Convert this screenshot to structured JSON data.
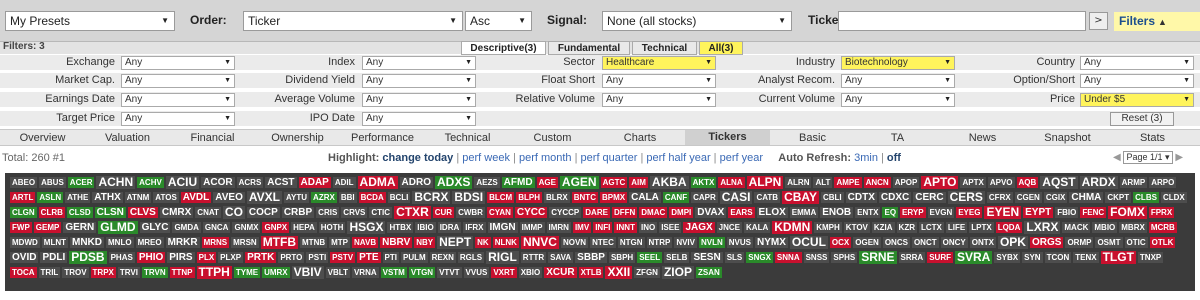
{
  "topbar": {
    "presets": "My Presets",
    "order_label": "Order:",
    "order_value": "Ticker",
    "order_dir": "Asc",
    "signal_label": "Signal:",
    "signal_value": "None (all stocks)",
    "tickers_label": "Tickers:",
    "tickers_value": "",
    "go_label": ">",
    "filters_label": "Filters"
  },
  "filter_header": {
    "count": "Filters: 3",
    "tabs": [
      "Descriptive(3)",
      "Fundamental",
      "Technical",
      "All(3)"
    ]
  },
  "filters": {
    "exchange": {
      "label": "Exchange",
      "value": "Any"
    },
    "index": {
      "label": "Index",
      "value": "Any"
    },
    "sector": {
      "label": "Sector",
      "value": "Healthcare"
    },
    "industry": {
      "label": "Industry",
      "value": "Biotechnology"
    },
    "country": {
      "label": "Country",
      "value": "Any"
    },
    "market_cap": {
      "label": "Market Cap.",
      "value": "Any"
    },
    "dividend_yield": {
      "label": "Dividend Yield",
      "value": "Any"
    },
    "float_short": {
      "label": "Float Short",
      "value": "Any"
    },
    "analyst_recom": {
      "label": "Analyst Recom.",
      "value": "Any"
    },
    "option_short": {
      "label": "Option/Short",
      "value": "Any"
    },
    "earnings_date": {
      "label": "Earnings Date",
      "value": "Any"
    },
    "average_volume": {
      "label": "Average Volume",
      "value": "Any"
    },
    "relative_volume": {
      "label": "Relative Volume",
      "value": "Any"
    },
    "current_volume": {
      "label": "Current Volume",
      "value": "Any"
    },
    "price": {
      "label": "Price",
      "value": "Under $5"
    },
    "target_price": {
      "label": "Target Price",
      "value": "Any"
    },
    "ipo_date": {
      "label": "IPO Date",
      "value": "Any"
    },
    "reset_label": "Reset (3)"
  },
  "nav": [
    "Overview",
    "Valuation",
    "Financial",
    "Ownership",
    "Performance",
    "Technical",
    "Custom",
    "Charts",
    "Tickers",
    "Basic",
    "TA",
    "News",
    "Snapshot",
    "Stats"
  ],
  "info": {
    "total": "Total: 260 #1",
    "highlight_label": "Highlight:",
    "highlight_links": [
      "change today",
      "perf week",
      "perf month",
      "perf quarter",
      "perf half year",
      "perf year"
    ],
    "refresh_label": "Auto Refresh:",
    "refresh_links": [
      "3min",
      "off"
    ],
    "page_value": "Page 1/1"
  },
  "colors": {
    "red": "#c8102e",
    "lightred": "#7a2a2a",
    "green": "#2a8a2a",
    "lightgreen": "#2f5e2f",
    "grey": "#4d4d4d"
  },
  "tickers": [
    [
      "ABEO",
      "g"
    ],
    [
      "ABUS",
      "g"
    ],
    [
      "ACER",
      "G"
    ],
    [
      "ACHN",
      "g",
      3
    ],
    [
      "ACHV",
      "G"
    ],
    [
      "ACIU",
      "g",
      3
    ],
    [
      "ACOR",
      "g",
      2
    ],
    [
      "ACRS",
      "g"
    ],
    [
      "ACST",
      "g",
      2
    ],
    [
      "ADAP",
      "R",
      2
    ],
    [
      "ADIL",
      "g"
    ],
    [
      "ADMA",
      "R",
      3
    ],
    [
      "ADRO",
      "g",
      2
    ],
    [
      "ADXS",
      "G",
      3
    ],
    [
      "AEZS",
      "g"
    ],
    [
      "AFMD",
      "G",
      2
    ],
    [
      "AGE",
      "R"
    ],
    [
      "AGEN",
      "G",
      3
    ],
    [
      "AGTC",
      "R"
    ],
    [
      "AIM",
      "R"
    ],
    [
      "AKBA",
      "g",
      3
    ],
    [
      "AKTX",
      "G"
    ],
    [
      "ALNA",
      "R"
    ],
    [
      "ALPN",
      "R",
      3
    ],
    [
      "ALRN",
      "g"
    ],
    [
      "ALT",
      "g"
    ],
    [
      "AMPE",
      "R"
    ],
    [
      "ANCN",
      "R"
    ],
    [
      "APOP",
      "g"
    ],
    [
      "APTO",
      "R",
      3
    ],
    [
      "APTX",
      "g"
    ],
    [
      "APVO",
      "g"
    ],
    [
      "AQB",
      "R"
    ],
    [
      "AQST",
      "g",
      3
    ],
    [
      "ARDX",
      "g",
      3
    ],
    [
      "ARMP",
      "g"
    ],
    [
      "ARPO",
      "g"
    ],
    [
      "ARTL",
      "R"
    ],
    [
      "ASLN",
      "G"
    ],
    [
      "ATHE",
      "g"
    ],
    [
      "ATHX",
      "g",
      2
    ],
    [
      "ATNM",
      "g"
    ],
    [
      "ATOS",
      "g"
    ],
    [
      "AVDL",
      "R",
      2
    ],
    [
      "AVEO",
      "g",
      2
    ],
    [
      "AVXL",
      "g",
      3
    ],
    [
      "AYTU",
      "g"
    ],
    [
      "AZRX",
      "G"
    ],
    [
      "BBI",
      "g"
    ],
    [
      "BCDA",
      "R"
    ],
    [
      "BCLI",
      "g"
    ],
    [
      "BCRX",
      "g",
      3
    ],
    [
      "BDSI",
      "g",
      3
    ],
    [
      "BLCM",
      "R"
    ],
    [
      "BLPH",
      "R"
    ],
    [
      "BLRX",
      "g"
    ],
    [
      "BNTC",
      "R"
    ],
    [
      "BPMX",
      "R"
    ],
    [
      "CALA",
      "g",
      2
    ],
    [
      "CANF",
      "G"
    ],
    [
      "CAPR",
      "g"
    ],
    [
      "CASI",
      "g",
      3
    ],
    [
      "CATB",
      "g"
    ],
    [
      "CBAY",
      "R",
      3
    ],
    [
      "CBLI",
      "g"
    ],
    [
      "CDTX",
      "g",
      2
    ],
    [
      "CDXC",
      "g",
      2
    ],
    [
      "CERC",
      "g",
      2
    ],
    [
      "CERS",
      "g",
      3
    ],
    [
      "CFRX",
      "g"
    ],
    [
      "CGEN",
      "g"
    ],
    [
      "CGIX",
      "g"
    ],
    [
      "CHMA",
      "g",
      2
    ],
    [
      "CKPT",
      "g"
    ],
    [
      "CLBS",
      "G"
    ],
    [
      "CLDX",
      "g"
    ],
    [
      "CLGN",
      "G"
    ],
    [
      "CLRB",
      "R"
    ],
    [
      "CLSD",
      "G"
    ],
    [
      "CLSN",
      "G",
      2
    ],
    [
      "CLVS",
      "R",
      2
    ],
    [
      "CMRX",
      "g",
      2
    ],
    [
      "CNAT",
      "g"
    ],
    [
      "CO",
      "g",
      3
    ],
    [
      "COCP",
      "g",
      2
    ],
    [
      "CRBP",
      "g",
      2
    ],
    [
      "CRIS",
      "g"
    ],
    [
      "CRVS",
      "g"
    ],
    [
      "CTIC",
      "g"
    ],
    [
      "CTXR",
      "R",
      3
    ],
    [
      "CUR",
      "R"
    ],
    [
      "CWBR",
      "g"
    ],
    [
      "CYAN",
      "R"
    ],
    [
      "CYCC",
      "R",
      2
    ],
    [
      "CYCCP",
      "g"
    ],
    [
      "DARE",
      "R"
    ],
    [
      "DFFN",
      "R"
    ],
    [
      "DMAC",
      "R"
    ],
    [
      "DMPI",
      "R"
    ],
    [
      "DVAX",
      "g",
      2
    ],
    [
      "EARS",
      "R"
    ],
    [
      "ELOX",
      "g",
      2
    ],
    [
      "EMMA",
      "g"
    ],
    [
      "ENOB",
      "g",
      2
    ],
    [
      "ENTX",
      "g"
    ],
    [
      "EQ",
      "G"
    ],
    [
      "ERYP",
      "R"
    ],
    [
      "EVGN",
      "g"
    ],
    [
      "EYEG",
      "R"
    ],
    [
      "EYEN",
      "R",
      3
    ],
    [
      "EYPT",
      "R",
      2
    ],
    [
      "FBIO",
      "g"
    ],
    [
      "FENC",
      "R"
    ],
    [
      "FOMX",
      "R",
      3
    ],
    [
      "FPRX",
      "R"
    ],
    [
      "FWP",
      "R"
    ],
    [
      "GEMP",
      "R"
    ],
    [
      "GERN",
      "g",
      2
    ],
    [
      "GLMD",
      "G",
      3
    ],
    [
      "GLYC",
      "g",
      2
    ],
    [
      "GMDA",
      "g"
    ],
    [
      "GNCA",
      "g"
    ],
    [
      "GNMX",
      "g"
    ],
    [
      "GNPX",
      "R"
    ],
    [
      "HEPA",
      "g"
    ],
    [
      "HOTH",
      "g"
    ],
    [
      "HSGX",
      "g",
      3
    ],
    [
      "HTBX",
      "g"
    ],
    [
      "IBIO",
      "g"
    ],
    [
      "IDRA",
      "g"
    ],
    [
      "IFRX",
      "g"
    ],
    [
      "IMGN",
      "g",
      2
    ],
    [
      "IMMP",
      "g"
    ],
    [
      "IMRN",
      "g"
    ],
    [
      "IMV",
      "R"
    ],
    [
      "INFI",
      "R"
    ],
    [
      "INNT",
      "R"
    ],
    [
      "INO",
      "g"
    ],
    [
      "ISEE",
      "g"
    ],
    [
      "JAGX",
      "R",
      2
    ],
    [
      "JNCE",
      "g"
    ],
    [
      "KALA",
      "g"
    ],
    [
      "KDMN",
      "R",
      3
    ],
    [
      "KMPH",
      "g"
    ],
    [
      "KTOV",
      "g"
    ],
    [
      "KZIA",
      "g"
    ],
    [
      "KZR",
      "g"
    ],
    [
      "LCTX",
      "g"
    ],
    [
      "LIFE",
      "g"
    ],
    [
      "LPTX",
      "g"
    ],
    [
      "LQDA",
      "R"
    ],
    [
      "LXRX",
      "g",
      3
    ],
    [
      "MACK",
      "g"
    ],
    [
      "MBIO",
      "g"
    ],
    [
      "MBRX",
      "g"
    ],
    [
      "MCRB",
      "R"
    ],
    [
      "MDWD",
      "g"
    ],
    [
      "MLNT",
      "g"
    ],
    [
      "MNKD",
      "g",
      2
    ],
    [
      "MNLO",
      "g"
    ],
    [
      "MREO",
      "g"
    ],
    [
      "MRKR",
      "g",
      2
    ],
    [
      "MRNS",
      "R"
    ],
    [
      "MRSN",
      "g"
    ],
    [
      "MTFB",
      "R",
      3
    ],
    [
      "MTNB",
      "g"
    ],
    [
      "MTP",
      "g"
    ],
    [
      "NAVB",
      "R"
    ],
    [
      "NBRV",
      "R",
      2
    ],
    [
      "NBY",
      "R"
    ],
    [
      "NEPT",
      "g",
      3
    ],
    [
      "NK",
      "R"
    ],
    [
      "NLNK",
      "R"
    ],
    [
      "NNVC",
      "R",
      3
    ],
    [
      "NOVN",
      "g"
    ],
    [
      "NTEC",
      "g"
    ],
    [
      "NTGN",
      "g"
    ],
    [
      "NTRP",
      "g"
    ],
    [
      "NVIV",
      "g"
    ],
    [
      "NVLN",
      "G"
    ],
    [
      "NVUS",
      "g"
    ],
    [
      "NYMX",
      "g",
      2
    ],
    [
      "OCUL",
      "g",
      3
    ],
    [
      "OCX",
      "R"
    ],
    [
      "OGEN",
      "g"
    ],
    [
      "ONCS",
      "g"
    ],
    [
      "ONCT",
      "g"
    ],
    [
      "ONCY",
      "g"
    ],
    [
      "ONTX",
      "g"
    ],
    [
      "OPK",
      "g",
      3
    ],
    [
      "ORGS",
      "R",
      2
    ],
    [
      "ORMP",
      "g"
    ],
    [
      "OSMT",
      "g"
    ],
    [
      "OTIC",
      "g"
    ],
    [
      "OTLK",
      "R"
    ],
    [
      "OVID",
      "g",
      2
    ],
    [
      "PDLI",
      "g",
      2
    ],
    [
      "PDSB",
      "G",
      3
    ],
    [
      "PHAS",
      "g"
    ],
    [
      "PHIO",
      "R",
      2
    ],
    [
      "PIRS",
      "g",
      2
    ],
    [
      "PLX",
      "R"
    ],
    [
      "PLXP",
      "g"
    ],
    [
      "PRTK",
      "R",
      2
    ],
    [
      "PRTO",
      "g"
    ],
    [
      "PSTI",
      "g"
    ],
    [
      "PSTV",
      "R"
    ],
    [
      "PTE",
      "R",
      2
    ],
    [
      "PTI",
      "g"
    ],
    [
      "PULM",
      "g"
    ],
    [
      "REXN",
      "g"
    ],
    [
      "RGLS",
      "g"
    ],
    [
      "RIGL",
      "g",
      3
    ],
    [
      "RTTR",
      "g"
    ],
    [
      "SAVA",
      "g"
    ],
    [
      "SBBP",
      "g",
      2
    ],
    [
      "SBPH",
      "g"
    ],
    [
      "SEEL",
      "G"
    ],
    [
      "SELB",
      "g"
    ],
    [
      "SESN",
      "g",
      2
    ],
    [
      "SLS",
      "g"
    ],
    [
      "SNGX",
      "G"
    ],
    [
      "SNNA",
      "R"
    ],
    [
      "SNSS",
      "g"
    ],
    [
      "SPHS",
      "g"
    ],
    [
      "SRNE",
      "G",
      3
    ],
    [
      "SRRA",
      "g"
    ],
    [
      "SURF",
      "R"
    ],
    [
      "SVRA",
      "G",
      3
    ],
    [
      "SYBX",
      "g"
    ],
    [
      "SYN",
      "g"
    ],
    [
      "TCON",
      "g"
    ],
    [
      "TENX",
      "g"
    ],
    [
      "TLGT",
      "R",
      3
    ],
    [
      "TNXP",
      "g"
    ],
    [
      "TOCA",
      "R"
    ],
    [
      "TRIL",
      "g"
    ],
    [
      "TROV",
      "g"
    ],
    [
      "TRPX",
      "R"
    ],
    [
      "TRVI",
      "g"
    ],
    [
      "TRVN",
      "G"
    ],
    [
      "TTNP",
      "R"
    ],
    [
      "TTPH",
      "R",
      3
    ],
    [
      "TYME",
      "G"
    ],
    [
      "UMRX",
      "G"
    ],
    [
      "VBIV",
      "g",
      3
    ],
    [
      "VBLT",
      "g"
    ],
    [
      "VRNA",
      "g"
    ],
    [
      "VSTM",
      "G"
    ],
    [
      "VTGN",
      "G"
    ],
    [
      "VTVT",
      "g"
    ],
    [
      "VVUS",
      "g"
    ],
    [
      "VXRT",
      "R"
    ],
    [
      "XBIO",
      "g"
    ],
    [
      "XCUR",
      "R",
      2
    ],
    [
      "XTLB",
      "R"
    ],
    [
      "XXII",
      "R",
      3
    ],
    [
      "ZFGN",
      "g"
    ],
    [
      "ZIOP",
      "g",
      3
    ],
    [
      "ZSAN",
      "G"
    ]
  ]
}
